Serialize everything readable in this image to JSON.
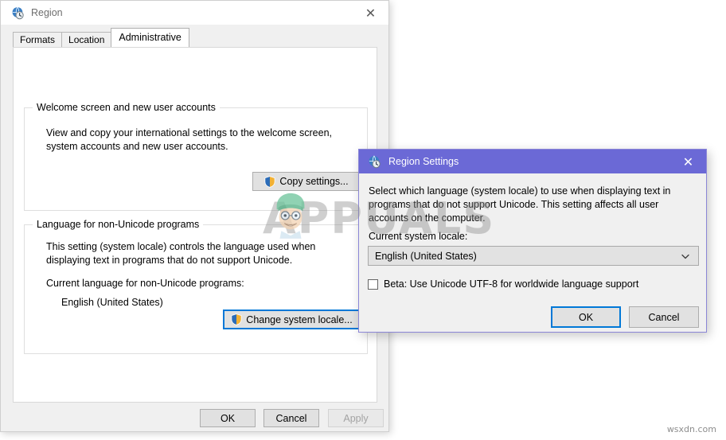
{
  "region_window": {
    "title": "Region",
    "title_icon": "globe-clock-icon",
    "close_label": "✕",
    "tabs": [
      {
        "label": "Formats",
        "selected": false
      },
      {
        "label": "Location",
        "selected": false
      },
      {
        "label": "Administrative",
        "selected": true
      }
    ],
    "welcome_group": {
      "legend": "Welcome screen and new user accounts",
      "description": "View and copy your international settings to the welcome screen, system accounts and new user accounts.",
      "copy_settings_label": "Copy settings..."
    },
    "language_group": {
      "legend": "Language for non-Unicode programs",
      "description": "This setting (system locale) controls the language used when displaying text in programs that do not support Unicode.",
      "current_label": "Current language for non-Unicode programs:",
      "current_value": "English (United States)",
      "change_locale_label": "Change system locale..."
    },
    "footer": {
      "ok_label": "OK",
      "cancel_label": "Cancel",
      "apply_label": "Apply"
    }
  },
  "region_settings_dialog": {
    "title": "Region Settings",
    "title_icon": "globe-clock-icon",
    "close_label": "✕",
    "description": "Select which language (system locale) to use when displaying text in programs that do not support Unicode. This setting affects all user accounts on the computer.",
    "locale_label": "Current system locale:",
    "locale_value": "English (United States)",
    "utf8_checkbox_label": "Beta: Use Unicode UTF-8 for worldwide language support",
    "utf8_checked": false,
    "ok_label": "OK",
    "cancel_label": "Cancel"
  },
  "watermarks": {
    "brand": "APPUALS",
    "site": "wsxdn.com"
  },
  "colors": {
    "dialog_titlebar": "#6b69d6",
    "focus_blue": "#0078d7",
    "window_bg": "#f0f0f0",
    "panel_bg": "#ffffff"
  }
}
